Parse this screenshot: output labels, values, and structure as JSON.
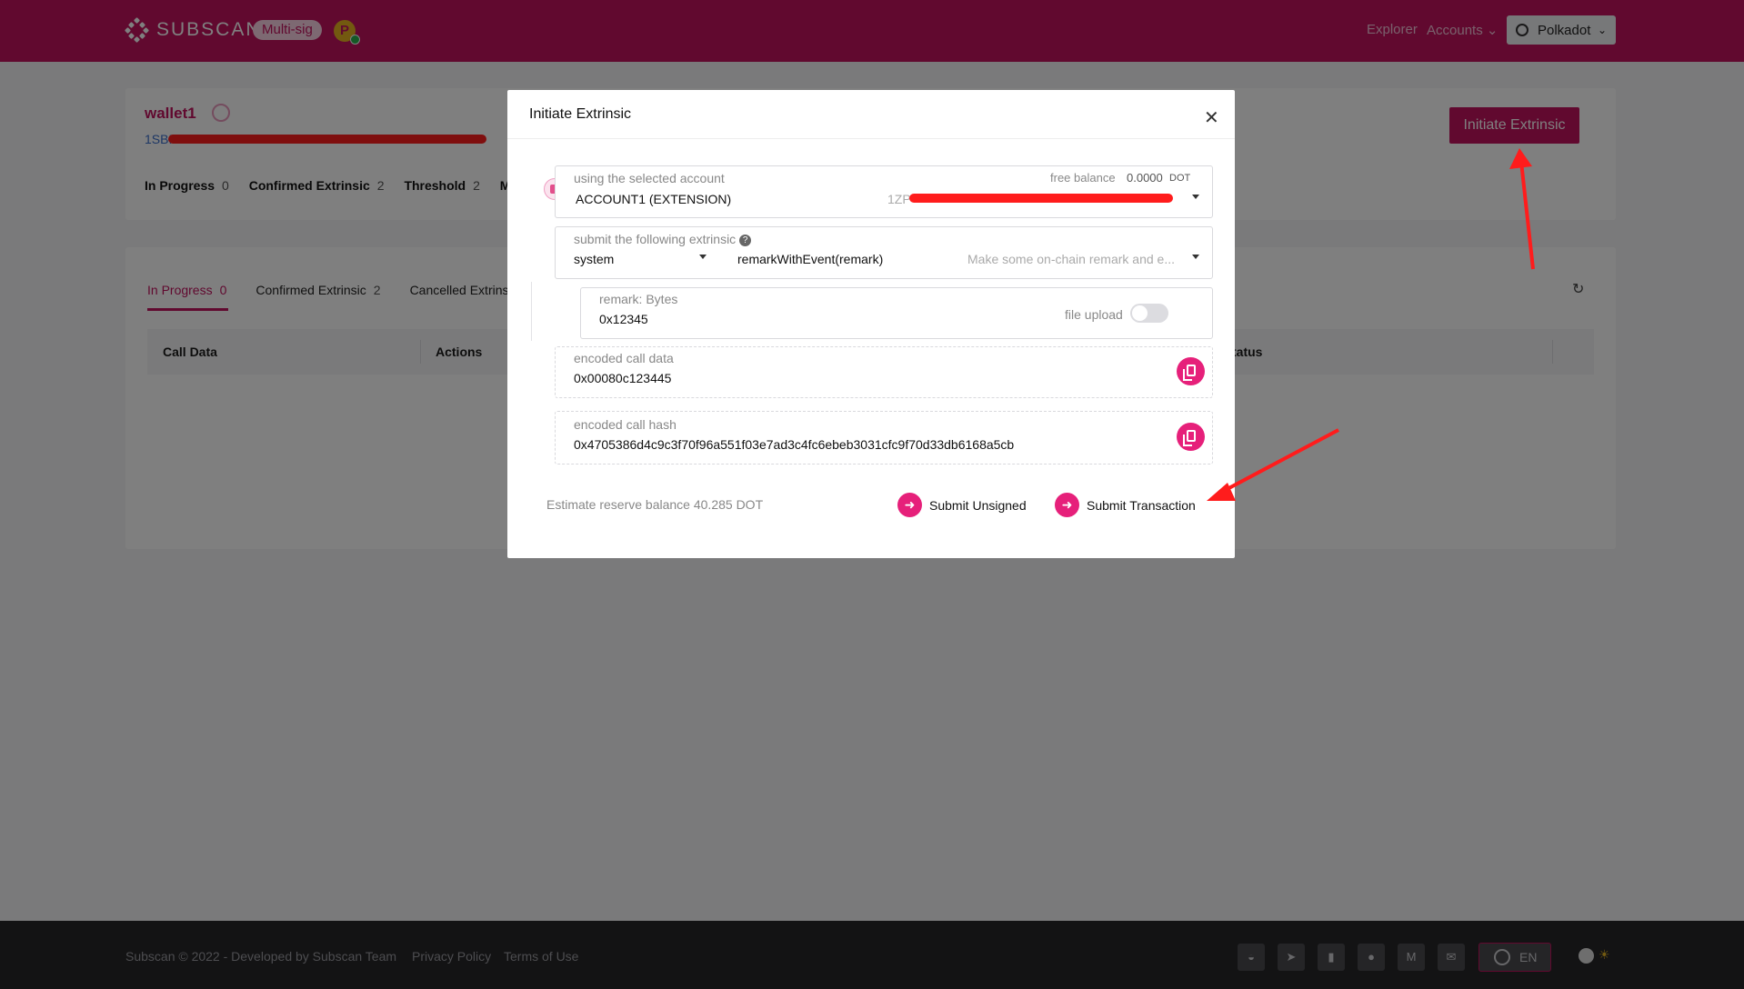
{
  "header": {
    "logo_text": "SUBSCAN",
    "badge": "Multi-sig",
    "network_badge": "P",
    "nav": {
      "explorer": "Explorer",
      "accounts": "Accounts"
    },
    "network_select": "Polkadot"
  },
  "wallet": {
    "name": "wallet1",
    "address_prefix": "1SBI",
    "stats": [
      {
        "label": "In Progress",
        "value": "0"
      },
      {
        "label": "Confirmed Extrinsic",
        "value": "2"
      },
      {
        "label": "Threshold",
        "value": "2"
      },
      {
        "label": "Men",
        "value": ""
      }
    ],
    "initiate_button": "Initiate Extrinsic"
  },
  "tabs": [
    {
      "label": "In Progress",
      "count": "0"
    },
    {
      "label": "Confirmed Extrinsic",
      "count": "2"
    },
    {
      "label": "Cancelled Extrins",
      "count": ""
    }
  ],
  "table": {
    "columns": [
      "Call Data",
      "Actions",
      "tatus"
    ]
  },
  "modal": {
    "title": "Initiate Extrinsic",
    "account": {
      "label": "using the selected account",
      "name": "ACCOUNT1 (EXTENSION)",
      "address_prefix": "1ZP",
      "free_balance_label": "free balance",
      "free_balance_value": "0.0000",
      "free_balance_unit": "DOT"
    },
    "extrinsic": {
      "label": "submit the following extrinsic",
      "module": "system",
      "method": "remarkWithEvent(remark)",
      "description": "Make some on-chain remark and e..."
    },
    "param": {
      "label": "remark: Bytes",
      "value": "0x12345",
      "file_upload_label": "file upload"
    },
    "call_data": {
      "label": "encoded call data",
      "value": "0x00080c123445"
    },
    "call_hash": {
      "label": "encoded call hash",
      "value": "0x4705386d4c9c3f70f96a551f03e7ad3c4fc6ebeb3031cfc9f70d33db6168a5cb"
    },
    "reserve_text": "Estimate reserve balance 40.285 DOT",
    "submit_unsigned": "Submit Unsigned",
    "submit_transaction": "Submit Transaction"
  },
  "footer": {
    "copyright": "Subscan © 2022 - Developed by Subscan Team",
    "privacy": "Privacy Policy",
    "terms": "Terms of Use",
    "language": "EN",
    "social_icons": [
      "element-icon",
      "telegram-icon",
      "bookmark-icon",
      "github-icon",
      "medium-icon",
      "email-icon"
    ]
  },
  "colors": {
    "brand": "#c2125f",
    "accent": "#e6207a",
    "annotation": "#ff1c1c"
  }
}
